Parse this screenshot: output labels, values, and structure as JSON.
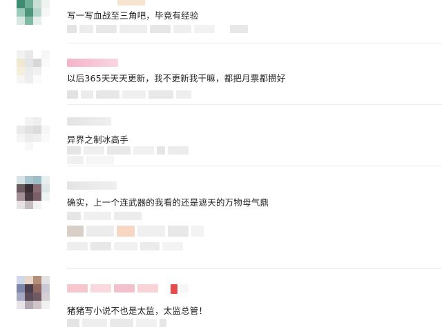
{
  "comments": [
    {
      "text": "写一写血战至三角吧，毕竟有经验"
    },
    {
      "text": "以后365天天天更新，我不更新我干嘛，都把月票都攒好"
    },
    {
      "text": "异界之制冰高手"
    },
    {
      "text": "确实，上一个连武器的我看的还是遮天的万物母气鼎"
    },
    {
      "text": "猪猪写小说不也是太监，太监总管！"
    }
  ]
}
